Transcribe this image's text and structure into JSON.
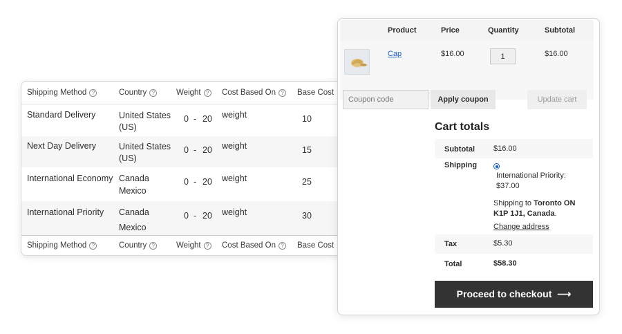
{
  "shipping_table": {
    "headers": {
      "method": "Shipping Method",
      "country": "Country",
      "weight": "Weight",
      "cost_based_on": "Cost Based On",
      "base_cost": "Base Cost"
    },
    "help_glyph": "?",
    "rows": [
      {
        "method": "Standard Delivery",
        "country_1": "United States",
        "country_2": "(US)",
        "weight_from": "0",
        "dash": "-",
        "weight_to": "20",
        "cost_based_on": "weight",
        "base_cost": "10"
      },
      {
        "method": "Next Day Delivery",
        "country_1": "United States",
        "country_2": "(US)",
        "weight_from": "0",
        "dash": "-",
        "weight_to": "20",
        "cost_based_on": "weight",
        "base_cost": "15"
      },
      {
        "method": "International Economy",
        "country_1": "Canada",
        "country_2": "Mexico",
        "weight_from": "0",
        "dash": "-",
        "weight_to": "20",
        "cost_based_on": "weight",
        "base_cost": "25"
      },
      {
        "method": "International Priority",
        "country_1": "Canada",
        "country_2": "Mexico",
        "weight_from": "0",
        "dash": "-",
        "weight_to": "20",
        "cost_based_on": "weight",
        "base_cost": "30"
      }
    ]
  },
  "cart": {
    "headers": {
      "product": "Product",
      "price": "Price",
      "quantity": "Quantity",
      "subtotal": "Subtotal"
    },
    "item": {
      "name": "Cap",
      "price": "$16.00",
      "quantity": "1",
      "subtotal": "$16.00",
      "thumbnail_icon": "cap-thumbnail"
    },
    "coupon_placeholder": "Coupon code",
    "apply_coupon_label": "Apply coupon",
    "update_cart_label": "Update cart"
  },
  "cart_totals": {
    "title": "Cart totals",
    "subtotal_label": "Subtotal",
    "subtotal_value": "$16.00",
    "shipping_label": "Shipping",
    "shipping_option_line1": "International Priority:",
    "shipping_option_line2": "$37.00",
    "shipping_to_prefix": "Shipping to ",
    "shipping_to_line1": "Toronto ON",
    "shipping_to_line2": "K1P 1J1, Canada",
    "shipping_to_suffix": ".",
    "change_address": "Change address",
    "tax_label": "Tax",
    "tax_value": "$5.30",
    "total_label": "Total",
    "total_value": "$58.30",
    "checkout_label": "Proceed to checkout",
    "checkout_arrow": "⟶"
  },
  "colors": {
    "link": "#1a5ec8",
    "checkout_bg": "#333333",
    "row_alt": "#f6f6f6"
  }
}
